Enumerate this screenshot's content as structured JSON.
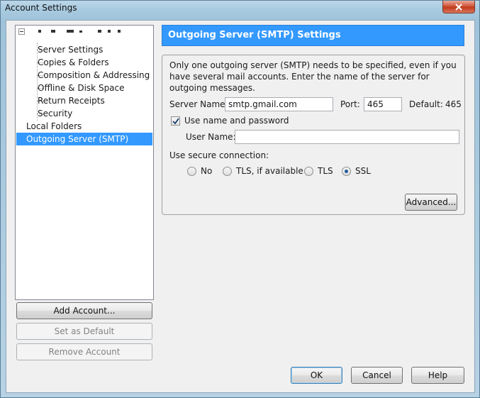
{
  "window": {
    "title": "Account Settings"
  },
  "tree": {
    "items": [
      {
        "label": "Server Settings"
      },
      {
        "label": "Copies & Folders"
      },
      {
        "label": "Composition & Addressing"
      },
      {
        "label": "Offline & Disk Space"
      },
      {
        "label": "Return Receipts"
      },
      {
        "label": "Security"
      },
      {
        "label": "Local Folders"
      },
      {
        "label": "Outgoing Server (SMTP)"
      }
    ]
  },
  "side_buttons": {
    "add_account": "Add Account...",
    "set_default": "Set as Default",
    "remove_account": "Remove Account"
  },
  "smtp": {
    "heading": "Outgoing Server (SMTP) Settings",
    "description": "Only one outgoing server (SMTP) needs to be specified, even if you have several mail accounts. Enter the name of the server for outgoing messages.",
    "server_name_label": "Server Name:",
    "server_name_value": "smtp.gmail.com",
    "port_label": "Port:",
    "port_value": "465",
    "default_label": "Default:",
    "default_value": "465",
    "use_name_password_label": "Use name and password",
    "use_name_password_checked": true,
    "user_name_label": "User Name:",
    "user_name_value": "",
    "secure_label": "Use secure connection:",
    "secure_options": [
      {
        "label": "No",
        "checked": false
      },
      {
        "label": "TLS, if available",
        "checked": false
      },
      {
        "label": "TLS",
        "checked": false
      },
      {
        "label": "SSL",
        "checked": true
      }
    ],
    "advanced_button": "Advanced..."
  },
  "dialog_buttons": {
    "ok": "OK",
    "cancel": "Cancel",
    "help": "Help"
  },
  "colors": {
    "selection": "#3399ff",
    "close_button": "#c23a1c"
  }
}
